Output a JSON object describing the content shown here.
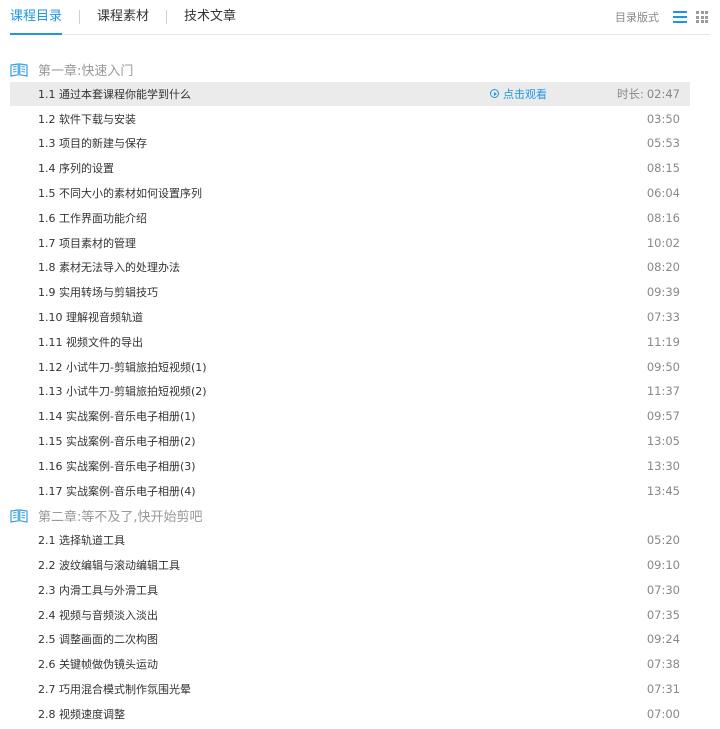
{
  "tabs": [
    "课程目录",
    "课程素材",
    "技术文章"
  ],
  "view": {
    "label": "目录版式"
  },
  "watch_label": "点击观看",
  "duration_label": "时长:",
  "colors": {
    "accent": "#1e96e6",
    "highlight_row": "#ebebeb",
    "chapter_text": "#999999"
  },
  "chapters": [
    {
      "title": "第一章:快速入门",
      "lessons": [
        {
          "title": "1.1 通过本套课程你能学到什么",
          "duration": "02:47",
          "active": true
        },
        {
          "title": "1.2 软件下载与安装",
          "duration": "03:50"
        },
        {
          "title": "1.3 项目的新建与保存",
          "duration": "05:53"
        },
        {
          "title": "1.4 序列的设置",
          "duration": "08:15"
        },
        {
          "title": "1.5 不同大小的素材如何设置序列",
          "duration": "06:04"
        },
        {
          "title": "1.6 工作界面功能介绍",
          "duration": "08:16"
        },
        {
          "title": "1.7 项目素材的管理",
          "duration": "10:02"
        },
        {
          "title": "1.8 素材无法导入的处理办法",
          "duration": "08:20"
        },
        {
          "title": "1.9 实用转场与剪辑技巧",
          "duration": "09:39"
        },
        {
          "title": "1.10 理解视音频轨道",
          "duration": "07:33"
        },
        {
          "title": "1.11 视频文件的导出",
          "duration": "11:19"
        },
        {
          "title": "1.12 小试牛刀-剪辑旅拍短视频(1)",
          "duration": "09:50"
        },
        {
          "title": "1.13 小试牛刀-剪辑旅拍短视频(2)",
          "duration": "11:37"
        },
        {
          "title": "1.14 实战案例-音乐电子相册(1)",
          "duration": "09:57"
        },
        {
          "title": "1.15 实战案例-音乐电子相册(2)",
          "duration": "13:05"
        },
        {
          "title": "1.16 实战案例-音乐电子相册(3)",
          "duration": "13:30"
        },
        {
          "title": "1.17 实战案例-音乐电子相册(4)",
          "duration": "13:45"
        }
      ]
    },
    {
      "title": "第二章:等不及了,快开始剪吧",
      "lessons": [
        {
          "title": "2.1 选择轨道工具",
          "duration": "05:20"
        },
        {
          "title": "2.2 波纹编辑与滚动编辑工具",
          "duration": "09:10"
        },
        {
          "title": "2.3 内滑工具与外滑工具",
          "duration": "07:30"
        },
        {
          "title": "2.4 视频与音频淡入淡出",
          "duration": "07:35"
        },
        {
          "title": "2.5 调整画面的二次构图",
          "duration": "09:24"
        },
        {
          "title": "2.6 关键帧做伪镜头运动",
          "duration": "07:38"
        },
        {
          "title": "2.7 巧用混合模式制作氛围光晕",
          "duration": "07:31"
        },
        {
          "title": "2.8 视频速度调整",
          "duration": "07:00"
        }
      ]
    }
  ]
}
